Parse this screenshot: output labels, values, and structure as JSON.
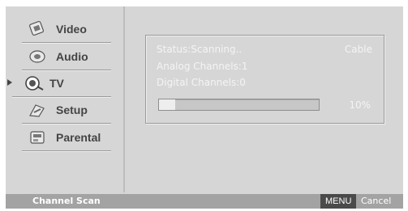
{
  "menu": {
    "items": [
      {
        "label": "Video",
        "icon": "video-icon"
      },
      {
        "label": "Audio",
        "icon": "audio-icon"
      },
      {
        "label": "TV",
        "icon": "tv-icon",
        "selected": true
      },
      {
        "label": "Setup",
        "icon": "setup-icon"
      },
      {
        "label": "Parental",
        "icon": "parental-icon"
      }
    ]
  },
  "scan": {
    "status": "Status:Scanning..",
    "source": "Cable",
    "analog": "Analog Channels:1",
    "digital": "Digital Channels:0",
    "progress_percent": 10,
    "progress_label": "10%"
  },
  "footer": {
    "title": "Channel Scan",
    "menu_key": "MENU",
    "cancel": "Cancel"
  }
}
